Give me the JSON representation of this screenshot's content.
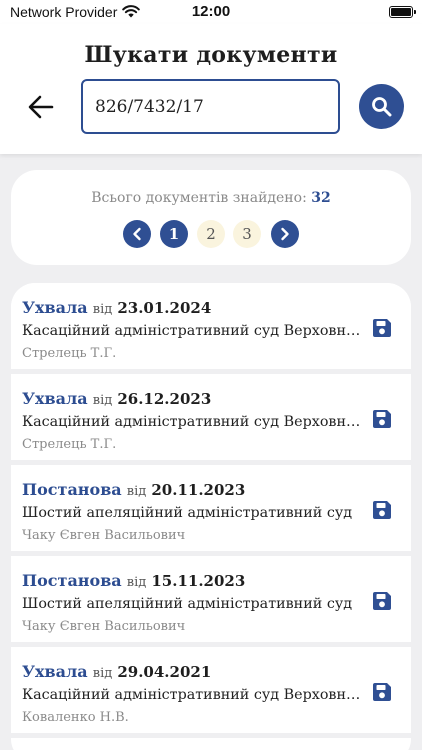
{
  "status_bar": {
    "carrier": "Network Provider",
    "time": "12:00"
  },
  "header": {
    "title": "Шукати документи",
    "back_icon": "arrow-left-icon",
    "search_value": "826/7432/17",
    "search_icon": "magnifier-icon"
  },
  "summary": {
    "found_label": "Всього документів знайдено:",
    "found_count": "32",
    "pages": [
      "1",
      "2",
      "3"
    ],
    "current_page": "1"
  },
  "colors": {
    "accent": "#2f4f93",
    "inactive_page": "#faf4de",
    "background": "#efeff1"
  },
  "documents": [
    {
      "type": "Ухвала",
      "from": "від",
      "date": "23.01.2024",
      "court": "Касаційний адміністративний суд Верховного Суду",
      "judge": "Стрелець Т.Г."
    },
    {
      "type": "Ухвала",
      "from": "від",
      "date": "26.12.2023",
      "court": "Касаційний адміністративний суд Верховного Суду",
      "judge": "Стрелець Т.Г."
    },
    {
      "type": "Постанова",
      "from": "від",
      "date": "20.11.2023",
      "court": "Шостий апеляційний адміністративний суд",
      "judge": "Чаку Євген Васильович"
    },
    {
      "type": "Постанова",
      "from": "від",
      "date": "15.11.2023",
      "court": "Шостий апеляційний адміністративний суд",
      "judge": "Чаку Євген Васильович"
    },
    {
      "type": "Ухвала",
      "from": "від",
      "date": "29.04.2021",
      "court": "Касаційний адміністративний суд Верховного Суду",
      "judge": "Коваленко Н.В."
    }
  ]
}
